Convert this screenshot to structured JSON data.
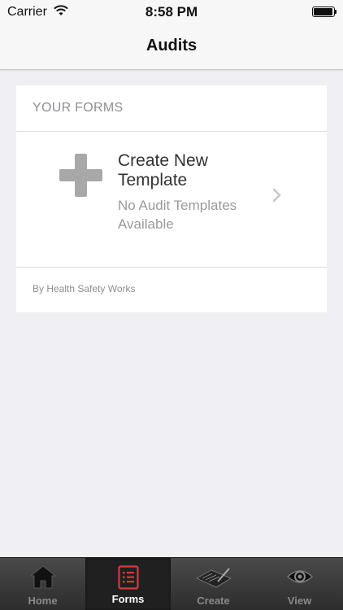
{
  "status_bar": {
    "carrier": "Carrier",
    "time": "8:58 PM"
  },
  "nav": {
    "title": "Audits"
  },
  "card": {
    "section_title": "YOUR FORMS",
    "create_title": "Create New Template",
    "create_subtitle": "No Audit Templates Available",
    "footer": "By Health Safety Works"
  },
  "tabs": [
    {
      "label": "Home",
      "icon": "home-icon",
      "selected": false
    },
    {
      "label": "Forms",
      "icon": "forms-icon",
      "selected": true
    },
    {
      "label": "Create",
      "icon": "create-icon",
      "selected": false
    },
    {
      "label": "View",
      "icon": "view-icon",
      "selected": false
    }
  ],
  "colors": {
    "background": "#efeff4",
    "forms_icon": "#d43b3b",
    "tab_bar": "#333333"
  }
}
